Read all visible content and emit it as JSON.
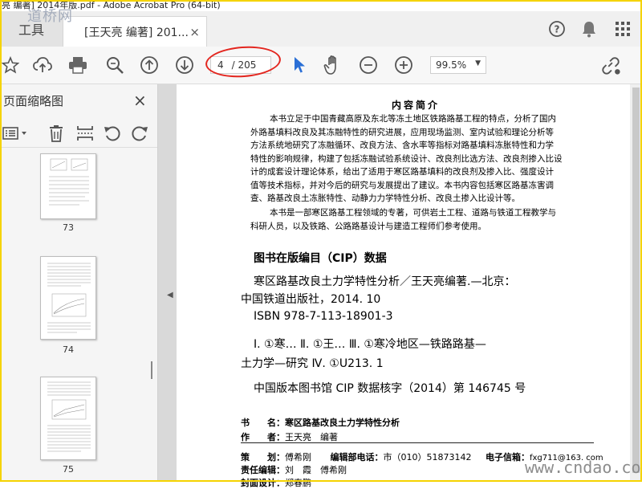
{
  "window": {
    "title": "亮 编著] 2014年版.pdf - Adobe Acrobat Pro (64-bit)"
  },
  "watermarks": {
    "top": "道桥网",
    "bottom": "www.cndao.com"
  },
  "tabs": {
    "tools": "工具",
    "document": "[王天亮 编著] 201...",
    "close": "×"
  },
  "toolbar": {
    "page_current": "4",
    "page_total": "/ 205",
    "zoom": "99.5%"
  },
  "sidepanel": {
    "title": "页面缩略图",
    "close": "×",
    "thumbnails": [
      {
        "label": "73"
      },
      {
        "label": "74"
      },
      {
        "label": "75"
      }
    ]
  },
  "document": {
    "intro_heading": "内容简介",
    "intro_lines": [
      "本书立足于中国青藏高原及东北等冻土地区铁路路基工程的特点，分析了国内",
      "外路基填料改良及其冻融特性的研究进展，应用现场监测、室内试验和理论分析等",
      "方法系统地研究了冻融循环、改良方法、含水率等指标对路基填料冻胀特性和力学",
      "特性的影响规律，构建了包括冻融试验系统设计、改良剂比选方法、改良剂掺入比设",
      "计的成套设计理论体系，给出了适用于寒区路基填料的改良剂及掺入比、强度设计",
      "值等技术指标，并对今后的研究与发展提出了建议。本书内容包括寒区路基冻害调",
      "查、路基改良土冻胀特性、动静力力学特性分析、改良土掺入比设计等。"
    ],
    "intro_lines2": [
      "本书是一部寒区路基工程领域的专著，可供岩土工程、道路与铁道工程教学与",
      "科研人员，以及铁路、公路路基设计与建造工程师们参考使用。"
    ],
    "cip_heading": "图书在版编目（CIP）数据",
    "cip_lines": [
      "寒区路基改良土力学特性分析／王天亮编著.—北京：",
      "中国铁道出版社，2014. 10",
      "ISBN 978-7-113-18901-3",
      "Ⅰ. ①寒… Ⅱ. ①王… Ⅲ. ①寒冷地区—铁路路基—",
      "土力学—研究 Ⅳ. ①U213. 1",
      "中国版本图书馆 CIP 数据核字（2014）第 146745 号"
    ],
    "meta": {
      "book_label": "书　　名：",
      "book_value": "寒区路基改良土力学特性分析",
      "author_label": "作　　者：",
      "author_value": "王天亮　编著",
      "planner_label": "策　　划：",
      "planner_value": "傅希刚",
      "phone_label": "编辑部电话：",
      "phone_value": "市（010）51873142",
      "email_label": "电子信箱：",
      "email_value": "fxg711@163. com",
      "editor_label": "责任编辑：",
      "editor_value": "刘　霞　傅希刚",
      "cover_label": "封面设计：",
      "cover_value": "郑春鹏"
    }
  }
}
